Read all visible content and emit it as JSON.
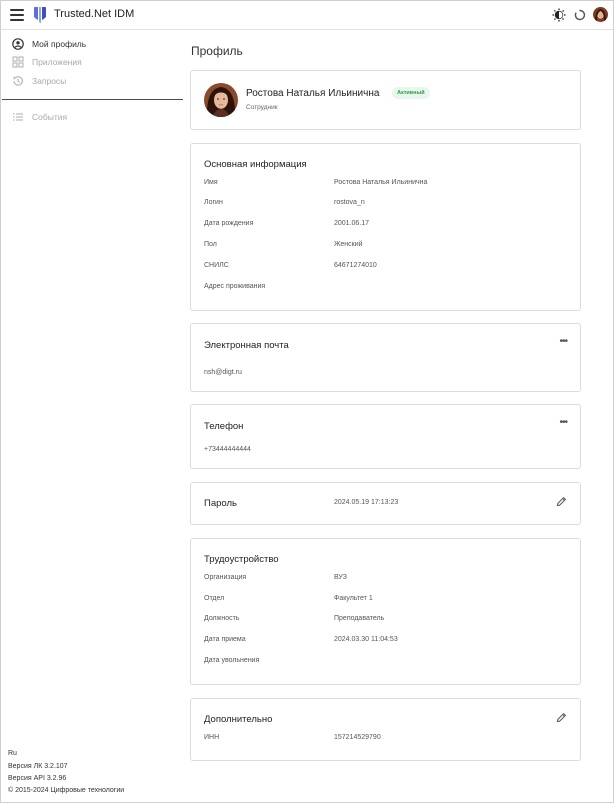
{
  "header": {
    "app_title": "Trusted.Net IDM"
  },
  "sidebar": {
    "items": [
      {
        "label": "Мой профиль",
        "icon": "user-circle-icon",
        "state": "active"
      },
      {
        "label": "Приложения",
        "icon": "grid-apps-icon",
        "state": "disabled"
      },
      {
        "label": "Запросы",
        "icon": "history-icon",
        "state": "disabled"
      },
      {
        "label": "События",
        "icon": "list-icon",
        "state": "disabled"
      }
    ],
    "footer": {
      "language": "Ru",
      "lk_version": "Версия ЛК 3.2.107",
      "api_version": "Версия API 3.2.96",
      "copyright": "© 2015-2024 Цифровые технологии"
    }
  },
  "main": {
    "page_title": "Профиль",
    "profile": {
      "name": "Ростова Наталья Ильинична",
      "role": "Сотрудник",
      "status": "Активный"
    },
    "basic_info": {
      "title": "Основная информация",
      "rows": [
        {
          "label": "Имя",
          "value": "Ростова Наталья Ильинична"
        },
        {
          "label": "Логин",
          "value": "rostova_n"
        },
        {
          "label": "Дата рождения",
          "value": "2001.06.17"
        },
        {
          "label": "Пол",
          "value": "Женский"
        },
        {
          "label": "СНИЛС",
          "value": "64671274010"
        },
        {
          "label": "Адрес проживания",
          "value": ""
        }
      ]
    },
    "email": {
      "title": "Электронная почта",
      "value": "nsh@digt.ru",
      "more": "•••"
    },
    "phone": {
      "title": "Телефон",
      "value": "+73444444444",
      "more": "•••"
    },
    "password": {
      "title": "Пароль",
      "value": "2024.05.19 17:13:23"
    },
    "employment": {
      "title": "Трудоустройство",
      "rows": [
        {
          "label": "Организация",
          "value": "ВУЗ"
        },
        {
          "label": "Отдел",
          "value": "Факультет 1"
        },
        {
          "label": "Должность",
          "value": "Преподаватель"
        },
        {
          "label": "Дата приема",
          "value": "2024.03.30 11:04:53"
        },
        {
          "label": "Дата увольнения",
          "value": ""
        }
      ]
    },
    "additional": {
      "title": "Дополнительно",
      "rows": [
        {
          "label": "ИНН",
          "value": "157214529790"
        }
      ]
    }
  },
  "colors": {
    "accent": "#3f51b5",
    "badge_bg": "#e8f7ec",
    "badge_text": "#2e9b4f"
  }
}
